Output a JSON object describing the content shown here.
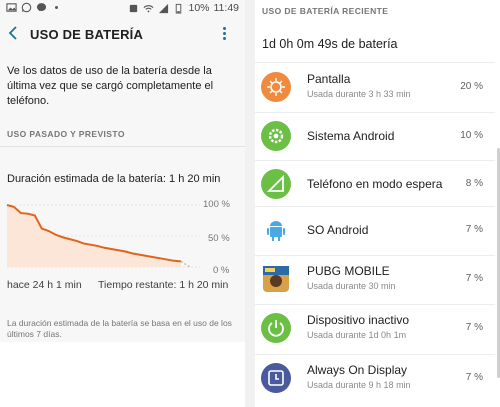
{
  "statusbar": {
    "battery": "10%",
    "time": "11:49"
  },
  "left": {
    "title": "USO DE BATERÍA",
    "intro": "Ve los datos de uso de la batería desde la última vez que se cargó completamente el teléfono.",
    "section_label": "USO PASADO Y PREVISTO",
    "estimate": "Duración estimada de la batería: 1 h 20 min",
    "chart_data": {
      "type": "line",
      "y_ticks": [
        "100 %",
        "50 %",
        "0 %"
      ],
      "ylim": [
        0,
        100
      ],
      "x": [
        0,
        1,
        2,
        3,
        4,
        5,
        6,
        7,
        8,
        9,
        10,
        11,
        12,
        13,
        14,
        15,
        16,
        17,
        18,
        19,
        20,
        21,
        22,
        23,
        24,
        25
      ],
      "values": [
        100,
        97,
        87,
        86,
        83,
        62,
        58,
        52,
        48,
        45,
        42,
        38,
        36,
        34,
        31,
        29,
        27,
        25,
        22,
        20,
        18,
        16,
        14,
        12,
        10,
        9
      ],
      "start_label": "hace 24 h 1 min",
      "end_label": "Tiempo restante: 1 h 20 min"
    },
    "note": "La duración estimada de la batería se basa en el uso de los últimos 7 días."
  },
  "right": {
    "section_label": "USO DE BATERÍA RECIENTE",
    "total": "1d 0h 0m 49s de batería",
    "apps": [
      {
        "name": "Pantalla",
        "sub": "Usada durante 3 h 33 min",
        "pct": "20 %",
        "icon": "brightness-icon",
        "color": "#f08a3e"
      },
      {
        "name": "Sistema Android",
        "sub": "",
        "pct": "10 %",
        "icon": "gear-icon",
        "color": "#6cbf45"
      },
      {
        "name": "Teléfono en modo espera",
        "sub": "",
        "pct": "8 %",
        "icon": "signal-icon",
        "color": "#6cbf45"
      },
      {
        "name": "SO Android",
        "sub": "",
        "pct": "7 %",
        "icon": "android-icon",
        "color": "#4aa8e8"
      },
      {
        "name": "PUBG MOBILE",
        "sub": "Usada durante 30 min",
        "pct": "7 %",
        "icon": "pubg-icon",
        "color": "#c98b3a"
      },
      {
        "name": "Dispositivo inactivo",
        "sub": "Usada durante 1d 0h 1m",
        "pct": "7 %",
        "icon": "power-icon",
        "color": "#6cbf45"
      },
      {
        "name": "Always On Display",
        "sub": "Usada durante 9 h 18 min",
        "pct": "7 %",
        "icon": "clock-icon",
        "color": "#4a5a9c"
      }
    ]
  }
}
